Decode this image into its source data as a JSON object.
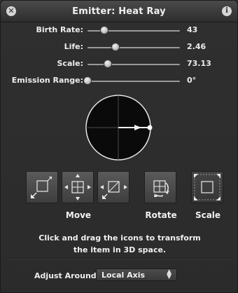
{
  "window": {
    "title": "Emitter: Heat Ray"
  },
  "sliders": [
    {
      "label": "Birth Rate:",
      "value": "43",
      "level": 0.18
    },
    {
      "label": "Life:",
      "value": "2.46",
      "level": 0.3
    },
    {
      "label": "Scale:",
      "value": "73.13",
      "level": 0.22
    },
    {
      "label": "Emission Range:",
      "value": "0°",
      "level": 0.0
    }
  ],
  "buttons": {
    "move_label": "Move",
    "rotate_label": "Rotate",
    "scale_label": "Scale"
  },
  "instructions": {
    "line1": "Click and drag the icons to transform",
    "line2": "the item in 3D space."
  },
  "adjust": {
    "label": "Adjust Around:",
    "selected": "Local Axis"
  },
  "icons": {
    "close": "close-icon",
    "info": "info-icon"
  }
}
